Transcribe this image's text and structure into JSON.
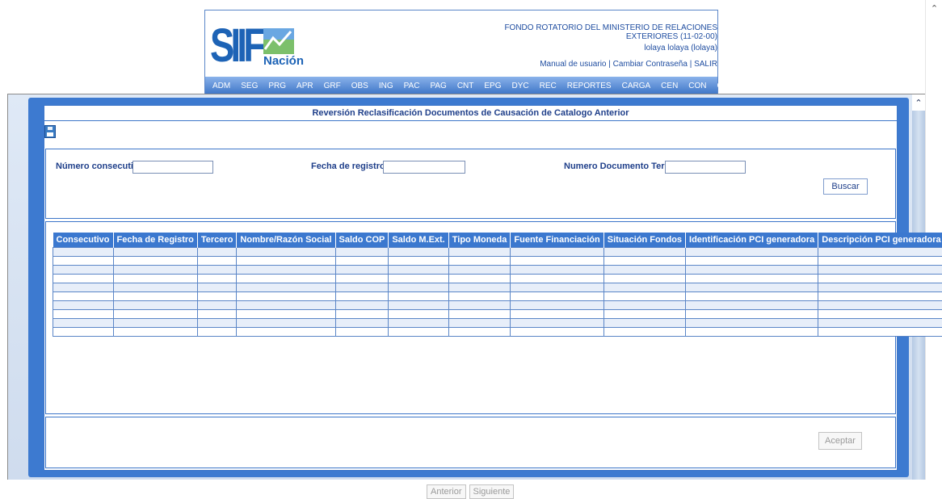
{
  "header": {
    "logo_text": "SIIF",
    "logo_subtext": "Nación",
    "org_line1": "FONDO ROTATORIO DEL MINISTERIO DE RELACIONES",
    "org_line2": "EXTERIORES (11-02-00)",
    "user": "lolaya lolaya (lolaya)",
    "links": [
      "Manual de usuario",
      "Cambiar Contraseña",
      "SALIR"
    ],
    "link_separator": "|",
    "menu": [
      "ADM",
      "SEG",
      "PRG",
      "APR",
      "GRF",
      "OBS",
      "ING",
      "PAC",
      "PAG",
      "CNT",
      "EPG",
      "DYC",
      "REC",
      "REPORTES",
      "CARGA",
      "CEN",
      "CON",
      "CUN"
    ]
  },
  "page": {
    "title": "Reversión Reclasificación Documentos de Causación de Catalogo Anterior"
  },
  "search": {
    "consecutivo_label": "Número consecutivo:",
    "consecutivo_value": "",
    "fecha_label": "Fecha de registro:",
    "fecha_value": "",
    "tercero_label": "Numero Documento Tercero:",
    "tercero_value": "",
    "buscar_label": "Buscar"
  },
  "grid": {
    "columns": [
      "Consecutivo",
      "Fecha de Registro",
      "Tercero",
      "Nombre/Razón Social",
      "Saldo COP",
      "Saldo M.Ext.",
      "Tipo Moneda",
      "Fuente Financiación",
      "Situación Fondos",
      "Identificación PCI generadora",
      "Descripción PCI generadora"
    ],
    "rows": [
      [
        "",
        "",
        "",
        "",
        "",
        "",
        "",
        "",
        "",
        "",
        ""
      ],
      [
        "",
        "",
        "",
        "",
        "",
        "",
        "",
        "",
        "",
        "",
        ""
      ],
      [
        "",
        "",
        "",
        "",
        "",
        "",
        "",
        "",
        "",
        "",
        ""
      ],
      [
        "",
        "",
        "",
        "",
        "",
        "",
        "",
        "",
        "",
        "",
        ""
      ],
      [
        "",
        "",
        "",
        "",
        "",
        "",
        "",
        "",
        "",
        "",
        ""
      ],
      [
        "",
        "",
        "",
        "",
        "",
        "",
        "",
        "",
        "",
        "",
        ""
      ],
      [
        "",
        "",
        "",
        "",
        "",
        "",
        "",
        "",
        "",
        "",
        ""
      ],
      [
        "",
        "",
        "",
        "",
        "",
        "",
        "",
        "",
        "",
        "",
        ""
      ],
      [
        "",
        "",
        "",
        "",
        "",
        "",
        "",
        "",
        "",
        "",
        ""
      ],
      [
        "",
        "",
        "",
        "",
        "",
        "",
        "",
        "",
        "",
        "",
        ""
      ]
    ]
  },
  "pager": {
    "prev_label": "Anterior",
    "next_label": "Siguiente"
  },
  "footer": {
    "accept_label": "Aceptar"
  },
  "icons": {
    "save": "floppy-disk-icon",
    "scroll_up": "chevron-up-icon"
  },
  "colors": {
    "accent": "#3b78cf",
    "frame": "#3d7ad0",
    "text": "#1f3f8a"
  }
}
